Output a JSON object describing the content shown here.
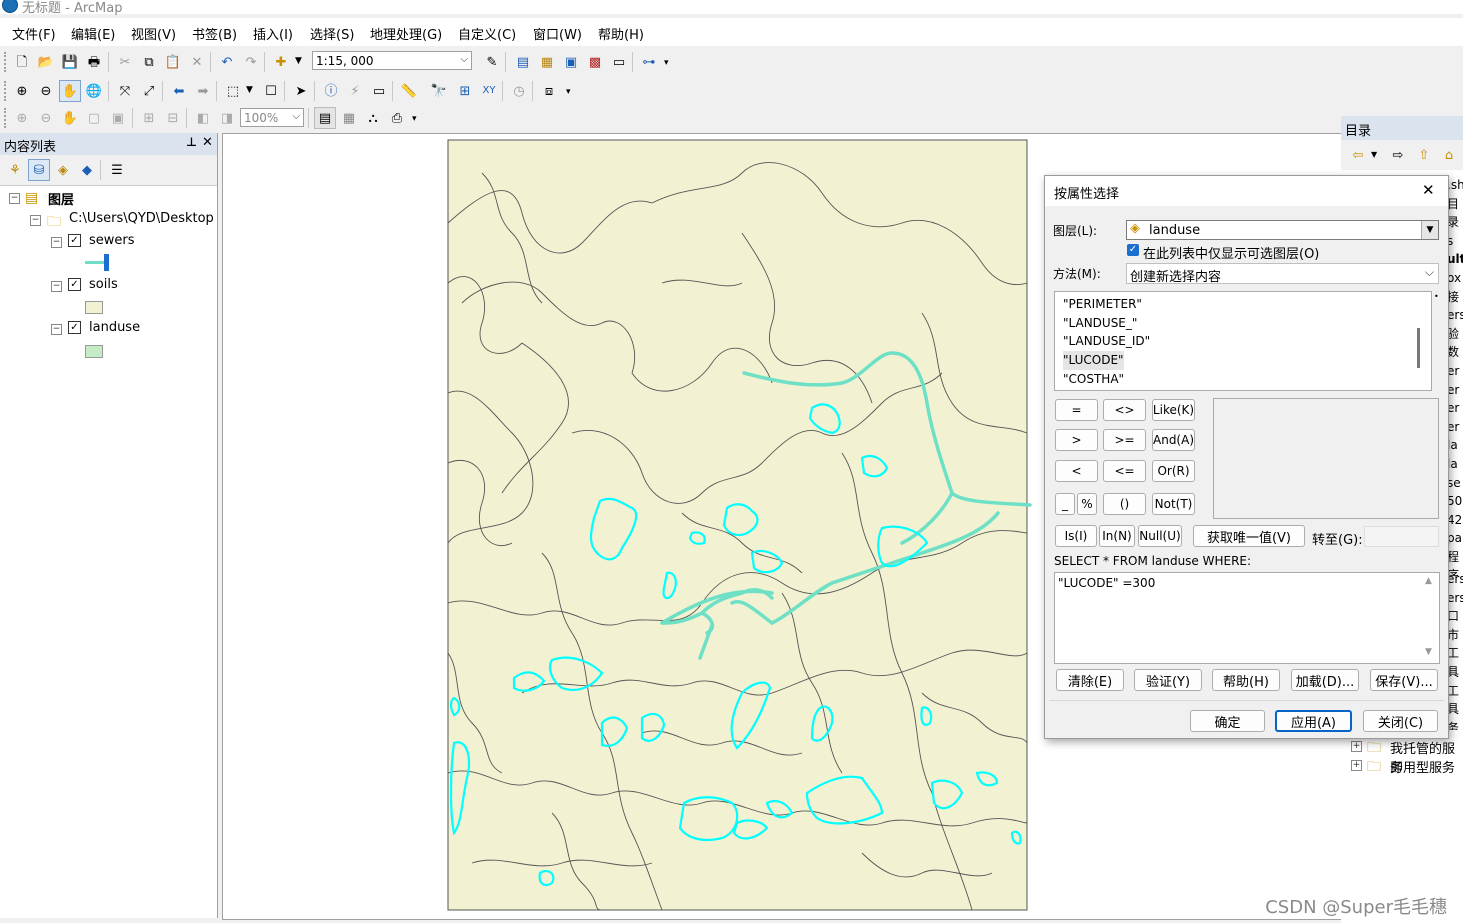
{
  "window": {
    "title": "无标题 - ArcMap"
  },
  "menu": [
    "文件(F)",
    "编辑(E)",
    "视图(V)",
    "书签(B)",
    "插入(I)",
    "选择(S)",
    "地理处理(G)",
    "自定义(C)",
    "窗口(W)",
    "帮助(H)"
  ],
  "toolbar": {
    "scale": "1:15, 000",
    "zoom": "100%"
  },
  "toc": {
    "title": "内容列表",
    "pin": "ᵖ",
    "close": "✕",
    "root": "图层",
    "folder": "C:\\Users\\QYD\\Desktop",
    "layers": [
      {
        "name": "sewers",
        "checked": true
      },
      {
        "name": "soils",
        "checked": true
      },
      {
        "name": "landuse",
        "checked": true
      }
    ]
  },
  "catalog": {
    "title": "目录",
    "right_snippets": [
      ".sh",
      "目录",
      "s",
      "ult.",
      "ox",
      "接",
      "ers",
      "验数",
      "er",
      "er",
      "er",
      "er",
      "la",
      "la",
      "se",
      "50",
      "42",
      "pa",
      "程序",
      "ers",
      "ers",
      "ers",
      "ers",
      "口市",
      "工具",
      "工具",
      "务器",
      "接",
      "器"
    ],
    "items": [
      "我托管的服务",
      "即用型服务"
    ]
  },
  "dialog": {
    "title": "按属性选择",
    "close": "✕",
    "layer_label": "图层(L):",
    "layer_value": "landuse",
    "only_selectable_label": "在此列表中仅显示可选图层(O)",
    "only_selectable_checked": true,
    "method_label": "方法(M):",
    "method_value": "创建新选择内容",
    "fields": [
      "\"PERIMETER\"",
      "\"LANDUSE_\"",
      "\"LANDUSE_ID\"",
      "\"LUCODE\"",
      "\"COSTHA\""
    ],
    "selected_field_index": 3,
    "operators": [
      [
        "=",
        "<>",
        "Like(K)"
      ],
      [
        ">",
        ">=",
        "And(A)"
      ],
      [
        "<",
        "<=",
        "Or(R)"
      ],
      [
        "_",
        "%",
        "()",
        "Not(T)"
      ]
    ],
    "is_btn": "Is(I)",
    "in_btn": "In(N)",
    "null_btn": "Null(U)",
    "unique_btn": "获取唯一值(V)",
    "goto_label": "转至(G):",
    "sql_prefix": "SELECT * FROM landuse WHERE:",
    "expression": "\"LUCODE\" =300",
    "row_buttons": [
      "清除(E)",
      "验证(Y)",
      "帮助(H)",
      "加载(D)...",
      "保存(V)..."
    ],
    "ok": "确定",
    "apply": "应用(A)",
    "closebtn": "关闭(C)"
  },
  "watermark": "CSDN @Super毛毛穗",
  "colors": {
    "map_fill": "#f2f2d2",
    "sewer": "#6de0c6",
    "selection": "#00ffff",
    "panel_header": "#dbe3ee"
  }
}
